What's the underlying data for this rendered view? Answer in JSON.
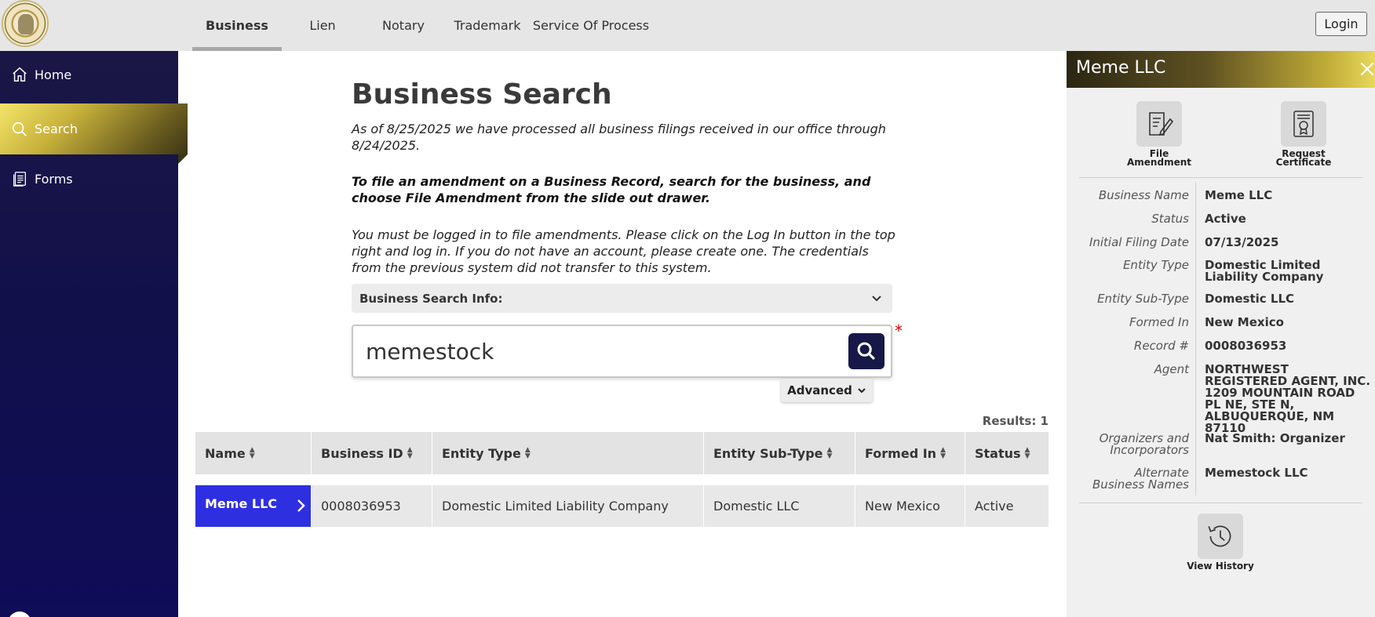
{
  "nav": {
    "tabs": [
      {
        "label": "Business",
        "active": true
      },
      {
        "label": "Lien"
      },
      {
        "label": "Notary"
      },
      {
        "label": "Trademark"
      },
      {
        "label": "Service Of Process"
      }
    ],
    "login_label": "Login"
  },
  "sidebar": {
    "items": [
      {
        "label": "Home",
        "icon": "home-icon"
      },
      {
        "label": "Search",
        "icon": "search-icon",
        "active": true
      },
      {
        "label": "Forms",
        "icon": "forms-icon"
      }
    ]
  },
  "main": {
    "title": "Business Search",
    "para1": "As of 8/25/2025 we have processed all business filings received in our office through 8/24/2025.",
    "para2": "To file an amendment on a Business Record, search for the business, and choose File Amendment from the slide out drawer.",
    "para3": "You must be logged in to file amendments. Please click on the Log In button in the top right and log in. If you do not have an account, please create one. The credentials from the previous system did not transfer to this system.",
    "info_label": "Business Search Info:",
    "search_value": "memestock",
    "required_mark": "*",
    "advanced_label": "Advanced",
    "results_text": "Results: 1"
  },
  "table": {
    "headers": [
      "Name",
      "Business ID",
      "Entity Type",
      "Entity Sub-Type",
      "Formed In",
      "Status"
    ],
    "rows": [
      [
        "Meme LLC",
        "0008036953",
        "Domestic Limited Liability Company",
        "Domestic LLC",
        "New Mexico",
        "Active"
      ]
    ]
  },
  "drawer": {
    "title": "Meme LLC",
    "actions": {
      "file_amendment": "File Amendment",
      "request_certificate": "Request Certificate",
      "view_history": "View History"
    },
    "details": [
      {
        "label": "Business Name",
        "value": "Meme LLC"
      },
      {
        "label": "Status",
        "value": "Active"
      },
      {
        "label": "Initial Filing Date",
        "value": "07/13/2025"
      },
      {
        "label": "Entity Type",
        "value": "Domestic Limited Liability Company"
      },
      {
        "label": "Entity Sub-Type",
        "value": "Domestic LLC"
      },
      {
        "label": "Formed In",
        "value": "New Mexico"
      },
      {
        "label": "Record #",
        "value": "0008036953"
      },
      {
        "label": "Agent",
        "value": "NORTHWEST REGISTERED AGENT, INC. 1209 MOUNTAIN ROAD PL NE, STE N, ALBUQUERQUE, NM 87110"
      },
      {
        "label": "Organizers and Incorporators",
        "value": "Nat Smith: Organizer"
      },
      {
        "label": "Alternate Business Names",
        "value": "Memestock LLC"
      }
    ]
  },
  "colors": {
    "sidebar_bg": "#12104a",
    "accent_gold": "#c8b23b",
    "selected_row": "#2e2fe0",
    "search_button": "#161848",
    "required": "#d10000"
  }
}
